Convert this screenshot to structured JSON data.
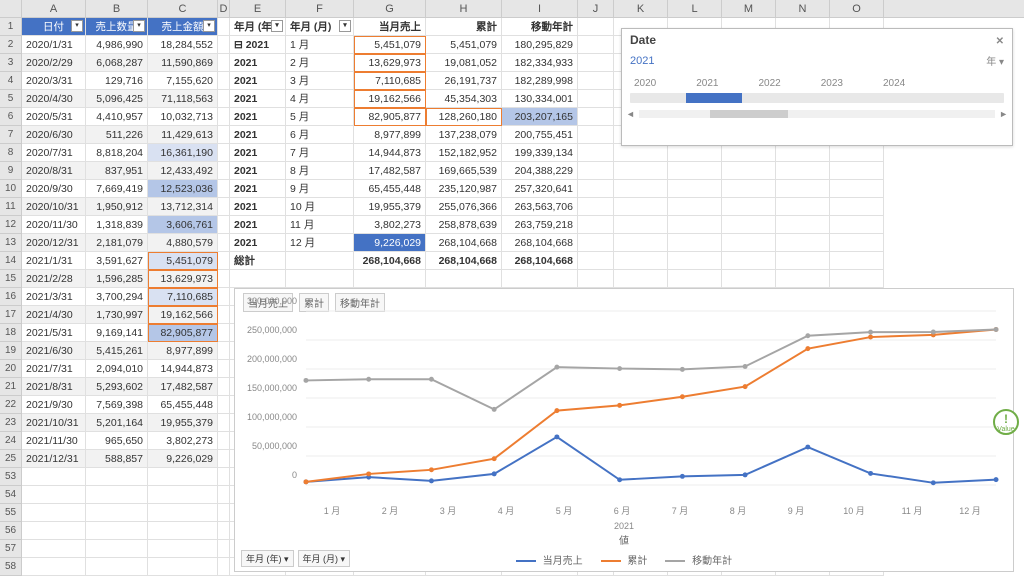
{
  "columns": [
    "A",
    "B",
    "C",
    "D",
    "E",
    "F",
    "G",
    "H",
    "I",
    "J",
    "K",
    "L",
    "M",
    "N",
    "O"
  ],
  "col_widths": {
    "A": 64,
    "B": 62,
    "C": 70,
    "D": 12,
    "E": 56,
    "F": 68,
    "G": 72,
    "H": 76,
    "I": 76,
    "J": 36,
    "K": 54,
    "L": 54,
    "M": 54,
    "N": 54,
    "O": 54
  },
  "row_numbers": [
    1,
    2,
    3,
    4,
    5,
    6,
    7,
    8,
    9,
    10,
    11,
    12,
    13,
    14,
    15,
    16,
    17,
    18,
    19,
    20,
    21,
    22,
    23,
    24,
    25,
    53,
    54,
    55,
    56,
    57,
    58
  ],
  "table_headers": {
    "A": "日付",
    "B": "売上数量",
    "C": "売上金額"
  },
  "pivot_headers": {
    "E": "年月 (年)",
    "F": "年月 (月)",
    "G": "当月売上",
    "H": "累計",
    "I": "移動年計"
  },
  "table_rows": [
    {
      "A": "2020/1/31",
      "B": "4,986,990",
      "C": "18,284,552"
    },
    {
      "A": "2020/2/29",
      "B": "6,068,287",
      "C": "11,590,869"
    },
    {
      "A": "2020/3/31",
      "B": "129,716",
      "C": "7,155,620"
    },
    {
      "A": "2020/4/30",
      "B": "5,096,425",
      "C": "71,118,563"
    },
    {
      "A": "2020/5/31",
      "B": "4,410,957",
      "C": "10,032,713"
    },
    {
      "A": "2020/6/30",
      "B": "511,226",
      "C": "11,429,613"
    },
    {
      "A": "2020/7/31",
      "B": "8,818,204",
      "C": "16,361,190"
    },
    {
      "A": "2020/8/31",
      "B": "837,951",
      "C": "12,433,492"
    },
    {
      "A": "2020/9/30",
      "B": "7,669,419",
      "C": "12,523,036"
    },
    {
      "A": "2020/10/31",
      "B": "1,950,912",
      "C": "13,712,314"
    },
    {
      "A": "2020/11/30",
      "B": "1,318,839",
      "C": "3,606,761"
    },
    {
      "A": "2020/12/31",
      "B": "2,181,079",
      "C": "4,880,579"
    },
    {
      "A": "2021/1/31",
      "B": "3,591,627",
      "C": "5,451,079"
    },
    {
      "A": "2021/2/28",
      "B": "1,596,285",
      "C": "13,629,973"
    },
    {
      "A": "2021/3/31",
      "B": "3,700,294",
      "C": "7,110,685"
    },
    {
      "A": "2021/4/30",
      "B": "1,730,997",
      "C": "19,162,566"
    },
    {
      "A": "2021/5/31",
      "B": "9,169,141",
      "C": "82,905,877"
    },
    {
      "A": "2021/6/30",
      "B": "5,415,261",
      "C": "8,977,899"
    },
    {
      "A": "2021/7/31",
      "B": "2,094,010",
      "C": "14,944,873"
    },
    {
      "A": "2021/8/31",
      "B": "5,293,602",
      "C": "17,482,587"
    },
    {
      "A": "2021/9/30",
      "B": "7,569,398",
      "C": "65,455,448"
    },
    {
      "A": "2021/10/31",
      "B": "5,201,164",
      "C": "19,955,379"
    },
    {
      "A": "2021/11/30",
      "B": "965,650",
      "C": "3,802,273"
    },
    {
      "A": "2021/12/31",
      "B": "588,857",
      "C": "9,226,029"
    }
  ],
  "pivot_rows": [
    {
      "E": "2021",
      "F": "1 月",
      "G": "5,451,079",
      "H": "5,451,079",
      "I": "180,295,829",
      "expand": "-"
    },
    {
      "E": "2021",
      "F": "2 月",
      "G": "13,629,973",
      "H": "19,081,052",
      "I": "182,334,933"
    },
    {
      "E": "2021",
      "F": "3 月",
      "G": "7,110,685",
      "H": "26,191,737",
      "I": "182,289,998"
    },
    {
      "E": "2021",
      "F": "4 月",
      "G": "19,162,566",
      "H": "45,354,303",
      "I": "130,334,001"
    },
    {
      "E": "2021",
      "F": "5 月",
      "G": "82,905,877",
      "H": "128,260,180",
      "I": "203,207,165"
    },
    {
      "E": "2021",
      "F": "6 月",
      "G": "8,977,899",
      "H": "137,238,079",
      "I": "200,755,451"
    },
    {
      "E": "2021",
      "F": "7 月",
      "G": "14,944,873",
      "H": "152,182,952",
      "I": "199,339,134"
    },
    {
      "E": "2021",
      "F": "8 月",
      "G": "17,482,587",
      "H": "169,665,539",
      "I": "204,388,229"
    },
    {
      "E": "2021",
      "F": "9 月",
      "G": "65,455,448",
      "H": "235,120,987",
      "I": "257,320,641"
    },
    {
      "E": "2021",
      "F": "10 月",
      "G": "19,955,379",
      "H": "255,076,366",
      "I": "263,563,706"
    },
    {
      "E": "2021",
      "F": "11 月",
      "G": "3,802,273",
      "H": "258,878,639",
      "I": "263,759,218"
    },
    {
      "E": "2021",
      "F": "12 月",
      "G": "9,226,029",
      "H": "268,104,668",
      "I": "268,104,668"
    }
  ],
  "pivot_total": {
    "E": "総計",
    "G": "268,104,668",
    "H": "268,104,668",
    "I": "268,104,668"
  },
  "slicer": {
    "title": "Date",
    "selected": "2021",
    "unit": "年",
    "labels": [
      "2020",
      "2021",
      "2022",
      "2023",
      "2024"
    ],
    "sel_start_pct": 15,
    "sel_end_pct": 30,
    "thumb_start_pct": 20,
    "thumb_end_pct": 42
  },
  "chart_data": {
    "type": "line",
    "title": "",
    "legend_top": [
      "当月売上",
      "累計",
      "移動年計"
    ],
    "axis_title": "値",
    "xyear": "2021",
    "categories": [
      "1 月",
      "2 月",
      "3 月",
      "4 月",
      "5 月",
      "6 月",
      "7 月",
      "8 月",
      "9 月",
      "10 月",
      "11 月",
      "12 月"
    ],
    "y_ticks": [
      0,
      50000000,
      100000000,
      150000000,
      200000000,
      250000000,
      300000000
    ],
    "y_tick_labels": [
      "0",
      "50,000,000",
      "100,000,000",
      "150,000,000",
      "200,000,000",
      "250,000,000",
      "300,000,000"
    ],
    "ylim": [
      0,
      300000000
    ],
    "series": [
      {
        "name": "当月売上",
        "color": "#4472c4",
        "values": [
          5451079,
          13629973,
          7110685,
          19162566,
          82905877,
          8977899,
          14944873,
          17482587,
          65455448,
          19955379,
          3802273,
          9226029
        ]
      },
      {
        "name": "累計",
        "color": "#ed7d31",
        "values": [
          5451079,
          19081052,
          26191737,
          45354303,
          128260180,
          137238079,
          152182952,
          169665539,
          235120987,
          255076366,
          258878639,
          268104668
        ]
      },
      {
        "name": "移動年計",
        "color": "#a5a5a5",
        "values": [
          180295829,
          182334933,
          182289998,
          130334001,
          203207165,
          200755451,
          199339134,
          204388229,
          257320641,
          263563706,
          263759218,
          268104668
        ]
      }
    ],
    "pivot_buttons": [
      "年月 (年)",
      "年月 (月)"
    ]
  },
  "colors": {
    "blue": "#4472c4",
    "orange": "#ed7d31",
    "grey": "#a5a5a5",
    "green": "#70ad47"
  }
}
